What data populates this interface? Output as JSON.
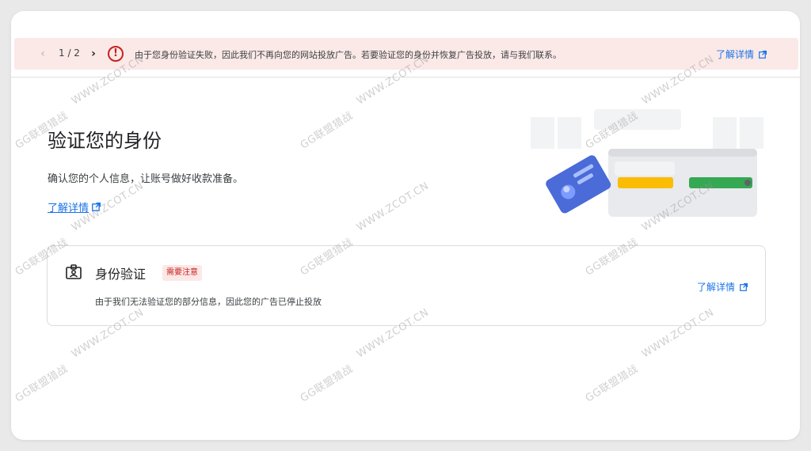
{
  "banner": {
    "pager_prev_icon": "chevron-left-icon",
    "pager_text": "1 / 2",
    "pager_next_icon": "chevron-right-icon",
    "alert_icon": "error-circle-icon",
    "message": "由于您身份验证失败，因此我们不再向您的网站投放广告。若要验证您的身份并恢复广告投放，请与我们联系。",
    "link_label": "了解详情",
    "link_icon": "open-in-new-icon",
    "background_color": "#fbe9e7",
    "alert_color": "#c5221f"
  },
  "header": {
    "title": "验证您的身份",
    "subtitle": "确认您的个人信息，让账号做好收款准备。",
    "learn_more_label": "了解详情",
    "illustration": "id-card-wallet-illustration"
  },
  "card": {
    "icon": "id-badge-icon",
    "title": "身份验证",
    "badge": "需要注意",
    "description": "由于我们无法验证您的部分信息，因此您的广告已停止投放",
    "link_label": "了解详情",
    "link_icon": "open-in-new-icon"
  },
  "watermark": {
    "brand": "GG联盟猎战",
    "site": "WWW.ZCOT.CN"
  },
  "colors": {
    "link": "#1a73e8",
    "badge_text": "#c5221f",
    "badge_bg": "#fce8e6"
  }
}
